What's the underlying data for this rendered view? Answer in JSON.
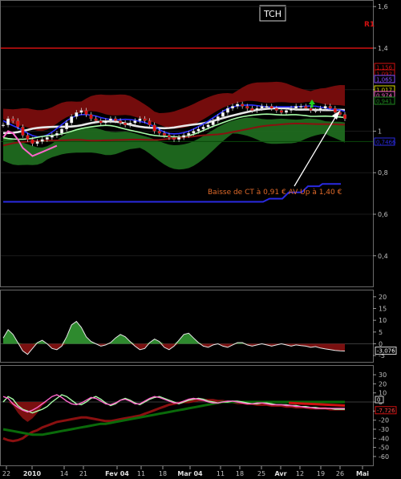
{
  "symbol": "TCH",
  "resistance_label": "R1",
  "annotation": "Baisse de CT  à 0,91 €    AV Up à 1,40 €",
  "colors": {
    "background": "#000000",
    "candle_up": "#ffffff",
    "candle_down": "#e01010",
    "resistance": "#d01010",
    "support": "#2a2ae0",
    "cloud_red": "#7a0d0d",
    "cloud_green": "#1f6a1f",
    "ma_white": "#e8e8e8",
    "ma_blue": "#3030ff",
    "ma_green_light": "#a8ffa8",
    "ma_dark_red": "#8a1010",
    "ma_dark_green": "#0a6a0a",
    "pink": "#ff66cc",
    "hist_green": "#2e8a2e",
    "hist_red": "#7a1010"
  },
  "chart_data": [
    {
      "type": "candlestick",
      "panel": "price",
      "ylim": [
        0.26,
        1.62
      ],
      "y_ticks": [
        "1,6",
        "1,4",
        "1,2",
        "1",
        "0,8",
        "0,6",
        "0,4"
      ],
      "x_ticks": [
        "22",
        "2010",
        "14",
        "21",
        "Fev 04",
        "11",
        "18",
        "Mar 04",
        "11",
        "18",
        "25",
        "Avr",
        "12",
        "19",
        "26",
        "Mai"
      ],
      "resistance_level": 1.4,
      "support_start": 0.66,
      "support_end": 0.746,
      "right_labels": [
        "1,156",
        "1,092",
        "1,065",
        "1,017",
        "0,974",
        "0,941",
        "0,7466"
      ],
      "closes": [
        1.03,
        1.06,
        1.05,
        1.02,
        0.98,
        0.96,
        0.94,
        0.95,
        0.96,
        0.97,
        0.98,
        0.99,
        1.01,
        1.04,
        1.07,
        1.09,
        1.1,
        1.08,
        1.06,
        1.05,
        1.04,
        1.05,
        1.06,
        1.05,
        1.04,
        1.03,
        1.04,
        1.05,
        1.06,
        1.05,
        1.03,
        1.0,
        0.99,
        0.98,
        0.97,
        0.96,
        0.97,
        0.98,
        0.99,
        1.0,
        1.01,
        1.02,
        1.03,
        1.05,
        1.07,
        1.09,
        1.11,
        1.12,
        1.13,
        1.12,
        1.11,
        1.1,
        1.11,
        1.12,
        1.12,
        1.11,
        1.1,
        1.09,
        1.1,
        1.11,
        1.12,
        1.12,
        1.11,
        1.1,
        1.1,
        1.11,
        1.12,
        1.11,
        1.09,
        1.08,
        1.06
      ]
    },
    {
      "type": "histogram",
      "panel": "momentum",
      "ylim": [
        -7,
        22
      ],
      "y_ticks": [
        "20",
        "15",
        "10",
        "5",
        "0",
        "-5"
      ],
      "current_value": "-3,076",
      "values": [
        2.5,
        6.0,
        4.0,
        0.5,
        -3.0,
        -4.5,
        -2.0,
        0.5,
        1.5,
        0.0,
        -2.0,
        -2.5,
        -1.0,
        3.0,
        8.0,
        9.5,
        7.0,
        3.0,
        1.0,
        0.0,
        -1.0,
        -0.5,
        0.5,
        2.5,
        4.0,
        3.0,
        1.0,
        -1.0,
        -2.5,
        -2.0,
        0.5,
        2.0,
        1.0,
        -1.5,
        -2.5,
        -1.0,
        1.5,
        4.0,
        4.5,
        2.5,
        0.5,
        -1.0,
        -1.5,
        -0.5,
        0.0,
        -1.0,
        -1.5,
        -0.5,
        0.5,
        0.5,
        -0.5,
        -1.0,
        -0.5,
        0.0,
        -0.5,
        -1.0,
        -0.5,
        0.0,
        -0.5,
        -1.0,
        -0.5,
        -0.8,
        -1.0,
        -1.5,
        -1.2,
        -1.8,
        -2.2,
        -2.5,
        -2.8,
        -3.0,
        -3.076
      ]
    },
    {
      "type": "line",
      "panel": "oscillator",
      "ylim": [
        -68,
        38
      ],
      "y_ticks": [
        "30",
        "20",
        "10",
        "0",
        "-10",
        "-20",
        "-30",
        "-40",
        "-50",
        "-60"
      ],
      "current_values": [
        "0",
        "-7,726"
      ],
      "histogram": [
        5,
        12,
        16,
        12,
        4,
        -6,
        -12,
        -14,
        -10,
        -6,
        -3,
        -1,
        0,
        0,
        0,
        0,
        0,
        0,
        0,
        0,
        0,
        0,
        0,
        0,
        0,
        0,
        0,
        0,
        0,
        0,
        0,
        0,
        0,
        0,
        0,
        0,
        0,
        0,
        0,
        0,
        0,
        0,
        0,
        0,
        0,
        0,
        0,
        0,
        0,
        0,
        0,
        0,
        0,
        0,
        0,
        0,
        0,
        0,
        0,
        0,
        0,
        0,
        0,
        0,
        0,
        0,
        0,
        0,
        0,
        0,
        0
      ],
      "series": [
        {
          "color": "ma_dark_red",
          "values": [
            -40,
            -42,
            -43,
            -42,
            -40,
            -36,
            -33,
            -31,
            -28,
            -26,
            -24,
            -22,
            -21,
            -20,
            -19,
            -18,
            -17,
            -17,
            -18,
            -19,
            -20,
            -21,
            -21,
            -20,
            -19,
            -18,
            -17,
            -16,
            -15,
            -13,
            -11,
            -9,
            -7,
            -5,
            -3,
            -2,
            -1,
            0,
            0,
            1,
            2,
            2,
            2,
            2,
            1,
            1,
            0,
            0,
            -1,
            -1,
            -2,
            -2,
            -3,
            -3,
            -3,
            -4,
            -4,
            -4,
            -5,
            -5,
            -6,
            -6,
            -6,
            -7,
            -7,
            -7,
            -7,
            -8,
            -8,
            -8,
            -8
          ]
        },
        {
          "color": "ma_dark_green",
          "values": [
            -30,
            -31,
            -32,
            -33,
            -34,
            -35,
            -36,
            -36,
            -36,
            -35,
            -34,
            -33,
            -32,
            -31,
            -30,
            -29,
            -28,
            -27,
            -26,
            -25,
            -24,
            -24,
            -23,
            -22,
            -21,
            -20,
            -19,
            -18,
            -17,
            -16,
            -15,
            -14,
            -13,
            -12,
            -11,
            -10,
            -9,
            -8,
            -7,
            -6,
            -5,
            -4,
            -3,
            -2,
            -1,
            0,
            0,
            0,
            0,
            0,
            0,
            0,
            0,
            0,
            0,
            0,
            0,
            0,
            0,
            0,
            0,
            0,
            0,
            0,
            0,
            0,
            0,
            0,
            0,
            0,
            0
          ]
        },
        {
          "color": "ma_green_light",
          "values": [
            0,
            6,
            3,
            -4,
            -8,
            -10,
            -12,
            -10,
            -8,
            -5,
            0,
            4,
            8,
            6,
            2,
            -2,
            -3,
            0,
            4,
            6,
            3,
            -1,
            -4,
            -2,
            2,
            4,
            2,
            -1,
            -3,
            0,
            3,
            5,
            6,
            4,
            2,
            0,
            -2,
            0,
            2,
            3,
            4,
            3,
            1,
            0,
            -1,
            0,
            0,
            1,
            1,
            0,
            -1,
            -2,
            -2,
            -1,
            -1,
            -2,
            -3,
            -3,
            -3,
            -4,
            -4,
            -5,
            -5,
            -6,
            -6,
            -7,
            -7,
            -7,
            -8,
            -8,
            -8
          ]
        },
        {
          "color": "pink",
          "values": [
            6,
            4,
            -2,
            -6,
            -9,
            -11,
            -9,
            -6,
            -2,
            2,
            6,
            8,
            5,
            1,
            -2,
            -3,
            -1,
            2,
            5,
            4,
            1,
            -2,
            -3,
            -1,
            2,
            3,
            1,
            -2,
            -2,
            1,
            4,
            6,
            5,
            3,
            1,
            -1,
            -1,
            1,
            3,
            4,
            3,
            2,
            0,
            -1,
            -1,
            0,
            1,
            1,
            0,
            -1,
            -2,
            -2,
            -1,
            -1,
            -2,
            -3,
            -3,
            -3,
            -4,
            -4,
            -5,
            -5,
            -6,
            -6,
            -7,
            -7,
            -7,
            -7,
            -7,
            -7,
            -7
          ]
        }
      ]
    }
  ]
}
